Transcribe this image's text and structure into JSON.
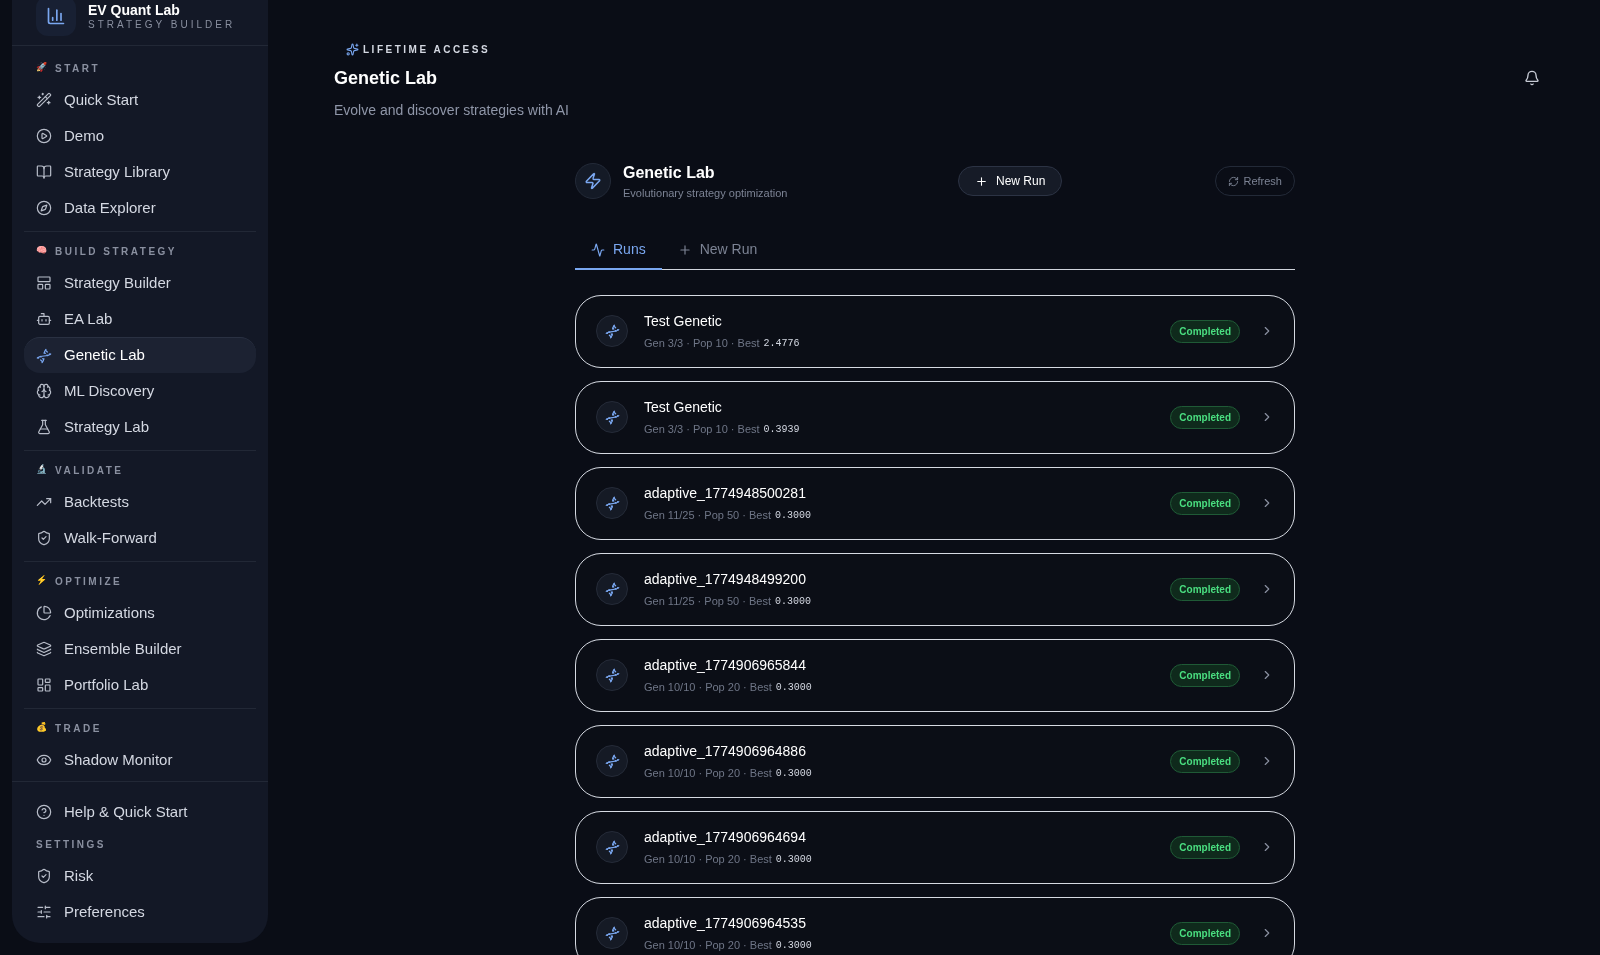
{
  "brand": {
    "name": "EV Quant Lab",
    "tagline": "STRATEGY BUILDER"
  },
  "sidebar": {
    "sections": [
      {
        "emoji": "🚀",
        "title": "START",
        "items": [
          {
            "label": "Quick Start",
            "selected": false
          },
          {
            "label": "Demo",
            "selected": false
          },
          {
            "label": "Strategy Library",
            "selected": false
          },
          {
            "label": "Data Explorer",
            "selected": false
          }
        ]
      },
      {
        "emoji": "🧠",
        "title": "BUILD STRATEGY",
        "items": [
          {
            "label": "Strategy Builder",
            "selected": false
          },
          {
            "label": "EA Lab",
            "selected": false
          },
          {
            "label": "Genetic Lab",
            "selected": true
          },
          {
            "label": "ML Discovery",
            "selected": false
          },
          {
            "label": "Strategy Lab",
            "selected": false
          }
        ]
      },
      {
        "emoji": "🔬",
        "title": "VALIDATE",
        "items": [
          {
            "label": "Backtests",
            "selected": false
          },
          {
            "label": "Walk-Forward",
            "selected": false
          }
        ]
      },
      {
        "emoji": "⚡",
        "title": "OPTIMIZE",
        "items": [
          {
            "label": "Optimizations",
            "selected": false
          },
          {
            "label": "Ensemble Builder",
            "selected": false
          },
          {
            "label": "Portfolio Lab",
            "selected": false
          }
        ]
      },
      {
        "emoji": "💰",
        "title": "TRADE",
        "items": [
          {
            "label": "Shadow Monitor",
            "selected": false
          }
        ]
      }
    ],
    "help": "Help & Quick Start",
    "settings": {
      "title": "SETTINGS",
      "items": [
        {
          "label": "Risk",
          "selected": false
        },
        {
          "label": "Preferences",
          "selected": false
        }
      ]
    }
  },
  "header": {
    "badge": "LIFETIME ACCESS",
    "title": "Genetic Lab",
    "subtitle": "Evolve and discover strategies with AI"
  },
  "panel": {
    "title": "Genetic Lab",
    "subtitle": "Evolutionary strategy optimization",
    "new_run": "New Run",
    "refresh": "Refresh",
    "tabs": [
      {
        "label": "Runs",
        "selected": true
      },
      {
        "label": "New Run",
        "selected": false
      }
    ],
    "runs": [
      {
        "name": "Test Genetic",
        "meta": "Gen 3/3 · Pop 10 · Best",
        "best": "2.4776",
        "status": "Completed",
        "kind": "completed"
      },
      {
        "name": "Test Genetic",
        "meta": "Gen 3/3 · Pop 10 · Best",
        "best": "0.3939",
        "status": "Completed",
        "kind": "completed"
      },
      {
        "name": "adaptive_1774948500281",
        "meta": "Gen 11/25 · Pop 50 · Best",
        "best": "0.3000",
        "status": "Completed",
        "kind": "completed"
      },
      {
        "name": "adaptive_1774948499200",
        "meta": "Gen 11/25 · Pop 50 · Best",
        "best": "0.3000",
        "status": "Completed",
        "kind": "completed"
      },
      {
        "name": "adaptive_1774906965844",
        "meta": "Gen 10/10 · Pop 20 · Best",
        "best": "0.3000",
        "status": "Completed",
        "kind": "completed"
      },
      {
        "name": "adaptive_1774906964886",
        "meta": "Gen 10/10 · Pop 20 · Best",
        "best": "0.3000",
        "status": "Completed",
        "kind": "completed"
      },
      {
        "name": "adaptive_1774906964694",
        "meta": "Gen 10/10 · Pop 20 · Best",
        "best": "0.3000",
        "status": "Completed",
        "kind": "completed"
      },
      {
        "name": "adaptive_1774906964535",
        "meta": "Gen 10/10 · Pop 20 · Best",
        "best": "0.3000",
        "status": "Completed",
        "kind": "completed"
      }
    ]
  }
}
